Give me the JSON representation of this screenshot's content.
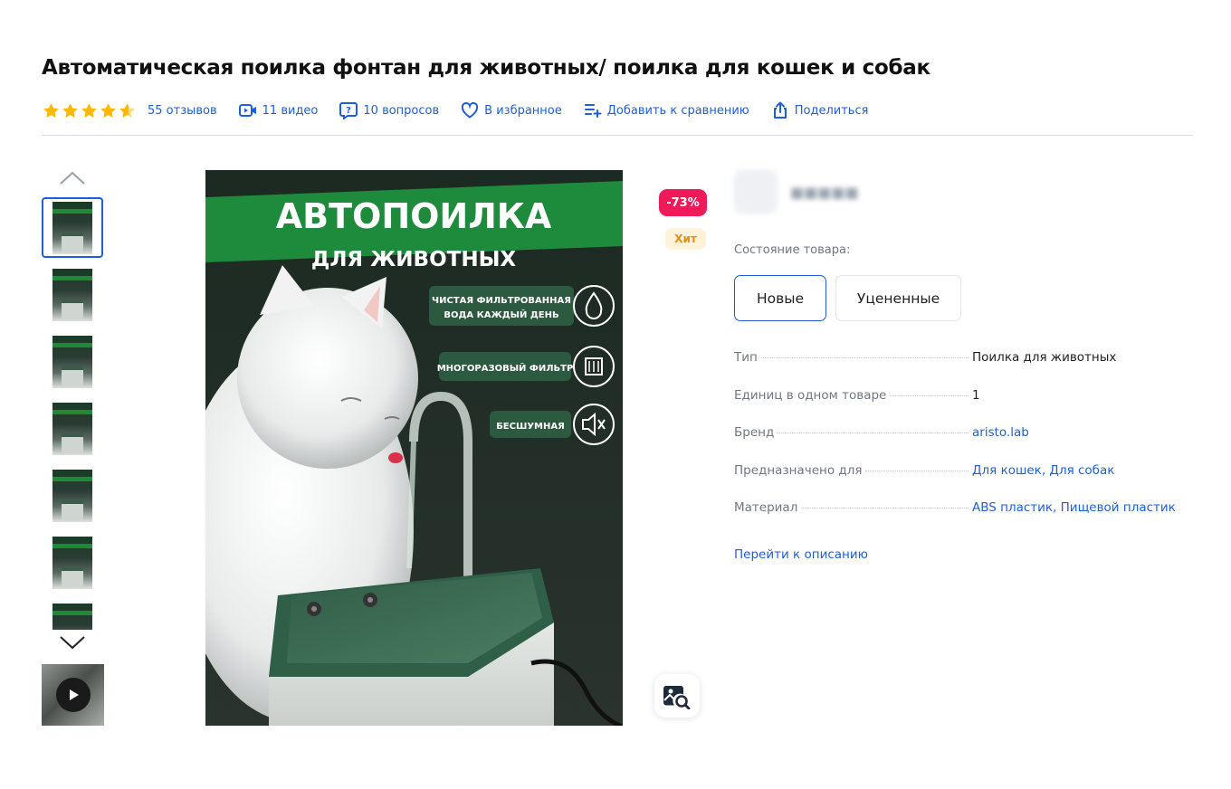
{
  "product": {
    "title": "Автоматическая поилка фонтан для животных/ поилка для кошек и собак"
  },
  "meta": {
    "rating_stars": 4.5,
    "reviews": "55 отзывов",
    "videos": "11 видео",
    "questions": "10 вопросов",
    "favorite": "В избранное",
    "compare": "Добавить к сравнению",
    "share": "Поделиться"
  },
  "gallery": {
    "main_image": {
      "banner_title": "АВТОПОИЛКА",
      "banner_subtitle": "ДЛЯ ЖИВОТНЫХ",
      "feature_1_line1": "ЧИСТАЯ ФИЛЬТРОВАННАЯ",
      "feature_1_line2": "ВОДА КАЖДЫЙ ДЕНЬ",
      "feature_2": "МНОГОРАЗОВЫЙ ФИЛЬТР",
      "feature_3": "БЕСШУМНАЯ"
    }
  },
  "badges": {
    "discount": "-73%",
    "hit": "Хит"
  },
  "condition": {
    "label": "Состояние товара:",
    "options": [
      "Новые",
      "Уцененные"
    ]
  },
  "specs": [
    {
      "key": "Тип",
      "value": "Поилка для животных"
    },
    {
      "key": "Единиц в одном товаре",
      "value": "1"
    },
    {
      "key": "Бренд",
      "value": "aristo.lab"
    },
    {
      "key": "Предназначено для",
      "value": "Для кошек, Для собак"
    },
    {
      "key": "Материал",
      "value": "ABS пластик, Пищевой пластик"
    }
  ],
  "goto_description": "Перейти к описанию",
  "colors": {
    "link": "#1f5edb",
    "star": "#ffb800",
    "sale": "#f0195a",
    "hit_bg": "#fff3d9",
    "hit_text": "#e8900c",
    "banner_green": "#1e8a3b"
  }
}
